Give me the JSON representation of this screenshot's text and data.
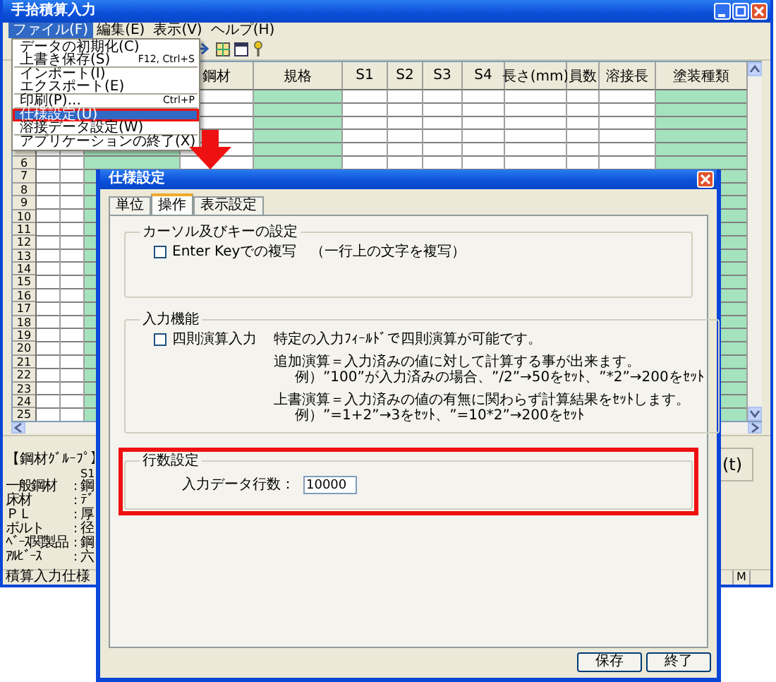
{
  "main_window": {
    "title": "手拾積算入力",
    "menu": [
      {
        "label": "ファイル(F)",
        "selected": true
      },
      {
        "label": "編集(E)",
        "selected": false
      },
      {
        "label": "表示(V)",
        "selected": false
      },
      {
        "label": "ヘルプ(H)",
        "selected": false
      }
    ],
    "grid": {
      "columns": [
        {
          "shaded": false
        },
        {
          "shaded": false
        },
        {
          "shaded": true
        },
        {
          "header": "鋼材",
          "shaded": false
        },
        {
          "header": "規格",
          "shaded": true
        },
        {
          "header": "S1",
          "shaded": false
        },
        {
          "header": "S2",
          "shaded": false
        },
        {
          "header": "S3",
          "shaded": false
        },
        {
          "header": "S4",
          "shaded": false
        },
        {
          "header": "長さ(mm)",
          "shaded": false
        },
        {
          "header": "員数",
          "shaded": false
        },
        {
          "header": "溶接長",
          "shaded": false
        },
        {
          "header": "塗装種類",
          "shaded": true
        }
      ],
      "row_numbers": [
        "6",
        "7",
        "8",
        "9",
        "10",
        "11",
        "12",
        "13",
        "14",
        "15",
        "16",
        "17",
        "18",
        "19",
        "20",
        "21",
        "22",
        "23",
        "24",
        "25"
      ]
    },
    "group_panel": {
      "title": "【鋼材ｸﾞﾙｰﾌﾟ】",
      "column_header": "S1",
      "rows": [
        {
          "label": "一般鋼材",
          "separator": ":",
          "value": "鋼"
        },
        {
          "label": "床材",
          "separator": ":",
          "value": "ﾃﾞ"
        },
        {
          "label": "ＰＬ",
          "separator": ":",
          "value": "厚"
        },
        {
          "label": "ボルト",
          "separator": ":",
          "value": "径"
        },
        {
          "label": "ﾍﾞｰｽ関製品",
          "separator": ":",
          "value": "鋼"
        },
        {
          "label": "ｱﾙﾋﾞｰｽ",
          "separator": ":",
          "value": "六"
        }
      ]
    },
    "unit_label": "(t)",
    "status_bar": [
      "積算入力仕様",
      "M"
    ]
  },
  "file_menu": {
    "items": [
      {
        "kind": "item",
        "label": "データの初期化(C)",
        "selected": false
      },
      {
        "kind": "item",
        "label": "上書き保存(S)",
        "shortcut": "F12, Ctrl+S",
        "selected": false
      },
      {
        "kind": "separator"
      },
      {
        "kind": "item",
        "label": "インポート(I)",
        "selected": false
      },
      {
        "kind": "item",
        "label": "エクスポート(E)",
        "selected": false
      },
      {
        "kind": "separator"
      },
      {
        "kind": "item",
        "label": "印刷(P)...",
        "shortcut": "Ctrl+P",
        "selected": false
      },
      {
        "kind": "separator"
      },
      {
        "kind": "item",
        "label": "仕様設定(U)",
        "selected": true
      },
      {
        "kind": "item",
        "label": "溶接データ設定(W)",
        "selected": false
      },
      {
        "kind": "separator"
      },
      {
        "kind": "item",
        "label": "アプリケーションの終了(X)",
        "selected": false
      }
    ]
  },
  "dialog": {
    "title": "仕様設定",
    "tabs": [
      {
        "label": "単位",
        "selected": false
      },
      {
        "label": "操作",
        "selected": true
      },
      {
        "label": "表示設定",
        "selected": false
      }
    ],
    "cursor_group": {
      "title": "カーソル及びキーの設定",
      "checkbox": {
        "label": "Enter Keyでの複写　（一行上の文字を複写）",
        "checked": false
      }
    },
    "input_group": {
      "title": "入力機能",
      "checkbox": {
        "label": "四則演算入力",
        "checked": false
      },
      "description": "特定の入力ﾌｨｰﾙﾄﾞで四則演算が可能です。",
      "notes": [
        {
          "text": "追加演算＝入力済みの値に対して計算する事が出来ます。",
          "example": "例）”100”が入力済みの場合、”/2”→50をｾｯﾄ、”*2”→200をｾｯﾄ"
        },
        {
          "text": "上書演算＝入力済みの値の有無に関わらず計算結果をｾｯﾄします。",
          "example": "例）”=1+2”→3をｾｯﾄ、”=10*2”→200をｾｯﾄ"
        }
      ]
    },
    "rows_group": {
      "title": "行数設定",
      "label": "入力データ行数：",
      "value": "10000",
      "highlighted": true
    },
    "buttons": [
      "保存",
      "終了"
    ]
  }
}
